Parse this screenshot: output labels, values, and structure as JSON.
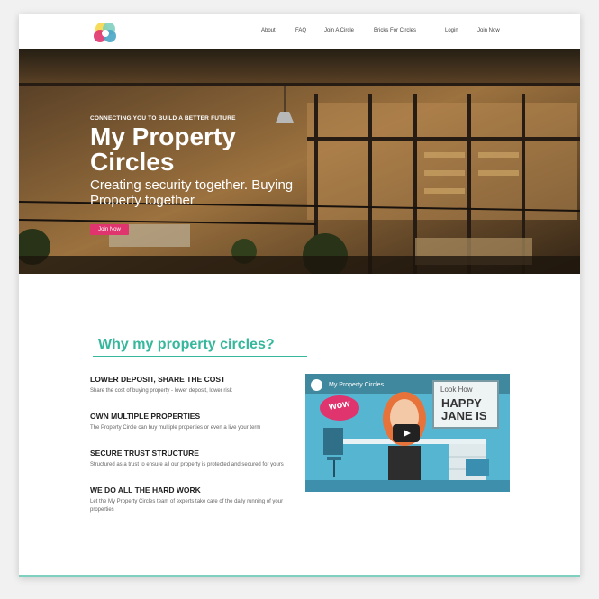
{
  "nav": {
    "logo_icon": "circles-logo-icon",
    "links": [
      "About",
      "FAQ",
      "Join A Circle",
      "Bricks For Circles",
      "Login",
      "Join Now"
    ]
  },
  "hero": {
    "kicker": "CONNECTING YOU TO BUILD A BETTER FUTURE",
    "title": "My Property Circles",
    "subtitle": "Creating security together. Buying Property together",
    "cta": "Join Now"
  },
  "why": {
    "title": "Why my property circles?",
    "features": [
      {
        "title": "LOWER DEPOSIT, SHARE THE COST",
        "body": "Share the cost of buying property - lower deposit, lower risk"
      },
      {
        "title": "OWN MULTIPLE PROPERTIES",
        "body": "The Property Circle can buy multiple properties or even a live your term"
      },
      {
        "title": "SECURE TRUST STRUCTURE",
        "body": "Structured as a trust to ensure all our property is protected and secured for yours"
      },
      {
        "title": "WE DO ALL THE HARD WORK",
        "body": "Let the My Property Circles team of experts take care of the daily running of your properties"
      }
    ]
  },
  "video": {
    "title": "My Property Circles",
    "bubble": "wow",
    "board_line1": "Look How",
    "board_line2": "HAPPY JANE IS"
  },
  "colors": {
    "accent": "#35b79c",
    "cta": "#e0346f"
  }
}
